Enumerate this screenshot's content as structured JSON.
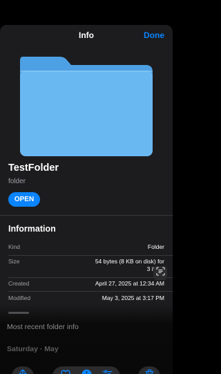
{
  "header": {
    "title": "Info",
    "done_label": "Done"
  },
  "item": {
    "name": "TestFolder",
    "kind_subtitle": "folder",
    "open_label": "OPEN"
  },
  "information": {
    "heading": "Information",
    "rows": [
      {
        "label": "Kind",
        "value": "Folder"
      },
      {
        "label": "Size",
        "value_line1": "54 bytes (8 KB on disk) for",
        "value_line2": "3 it"
      },
      {
        "label": "Created",
        "value": "April 27, 2025 at 12:34 AM"
      },
      {
        "label": "Modified",
        "value": "May 3, 2025 at 3:17 PM"
      }
    ]
  },
  "background": {
    "folder_info_label": "Most recent folder info",
    "date_fragment": "Saturday · May"
  },
  "toolbar": {
    "buttons": [
      "share-icon",
      "heart-icon",
      "info-icon",
      "sliders-icon",
      "trash-icon"
    ]
  },
  "colors": {
    "accent": "#0a84ff",
    "sheet_background": "#1c1c1e",
    "folder_front": "#6ab8f2",
    "folder_back": "#4da0e3",
    "trash": "#ff453a"
  }
}
